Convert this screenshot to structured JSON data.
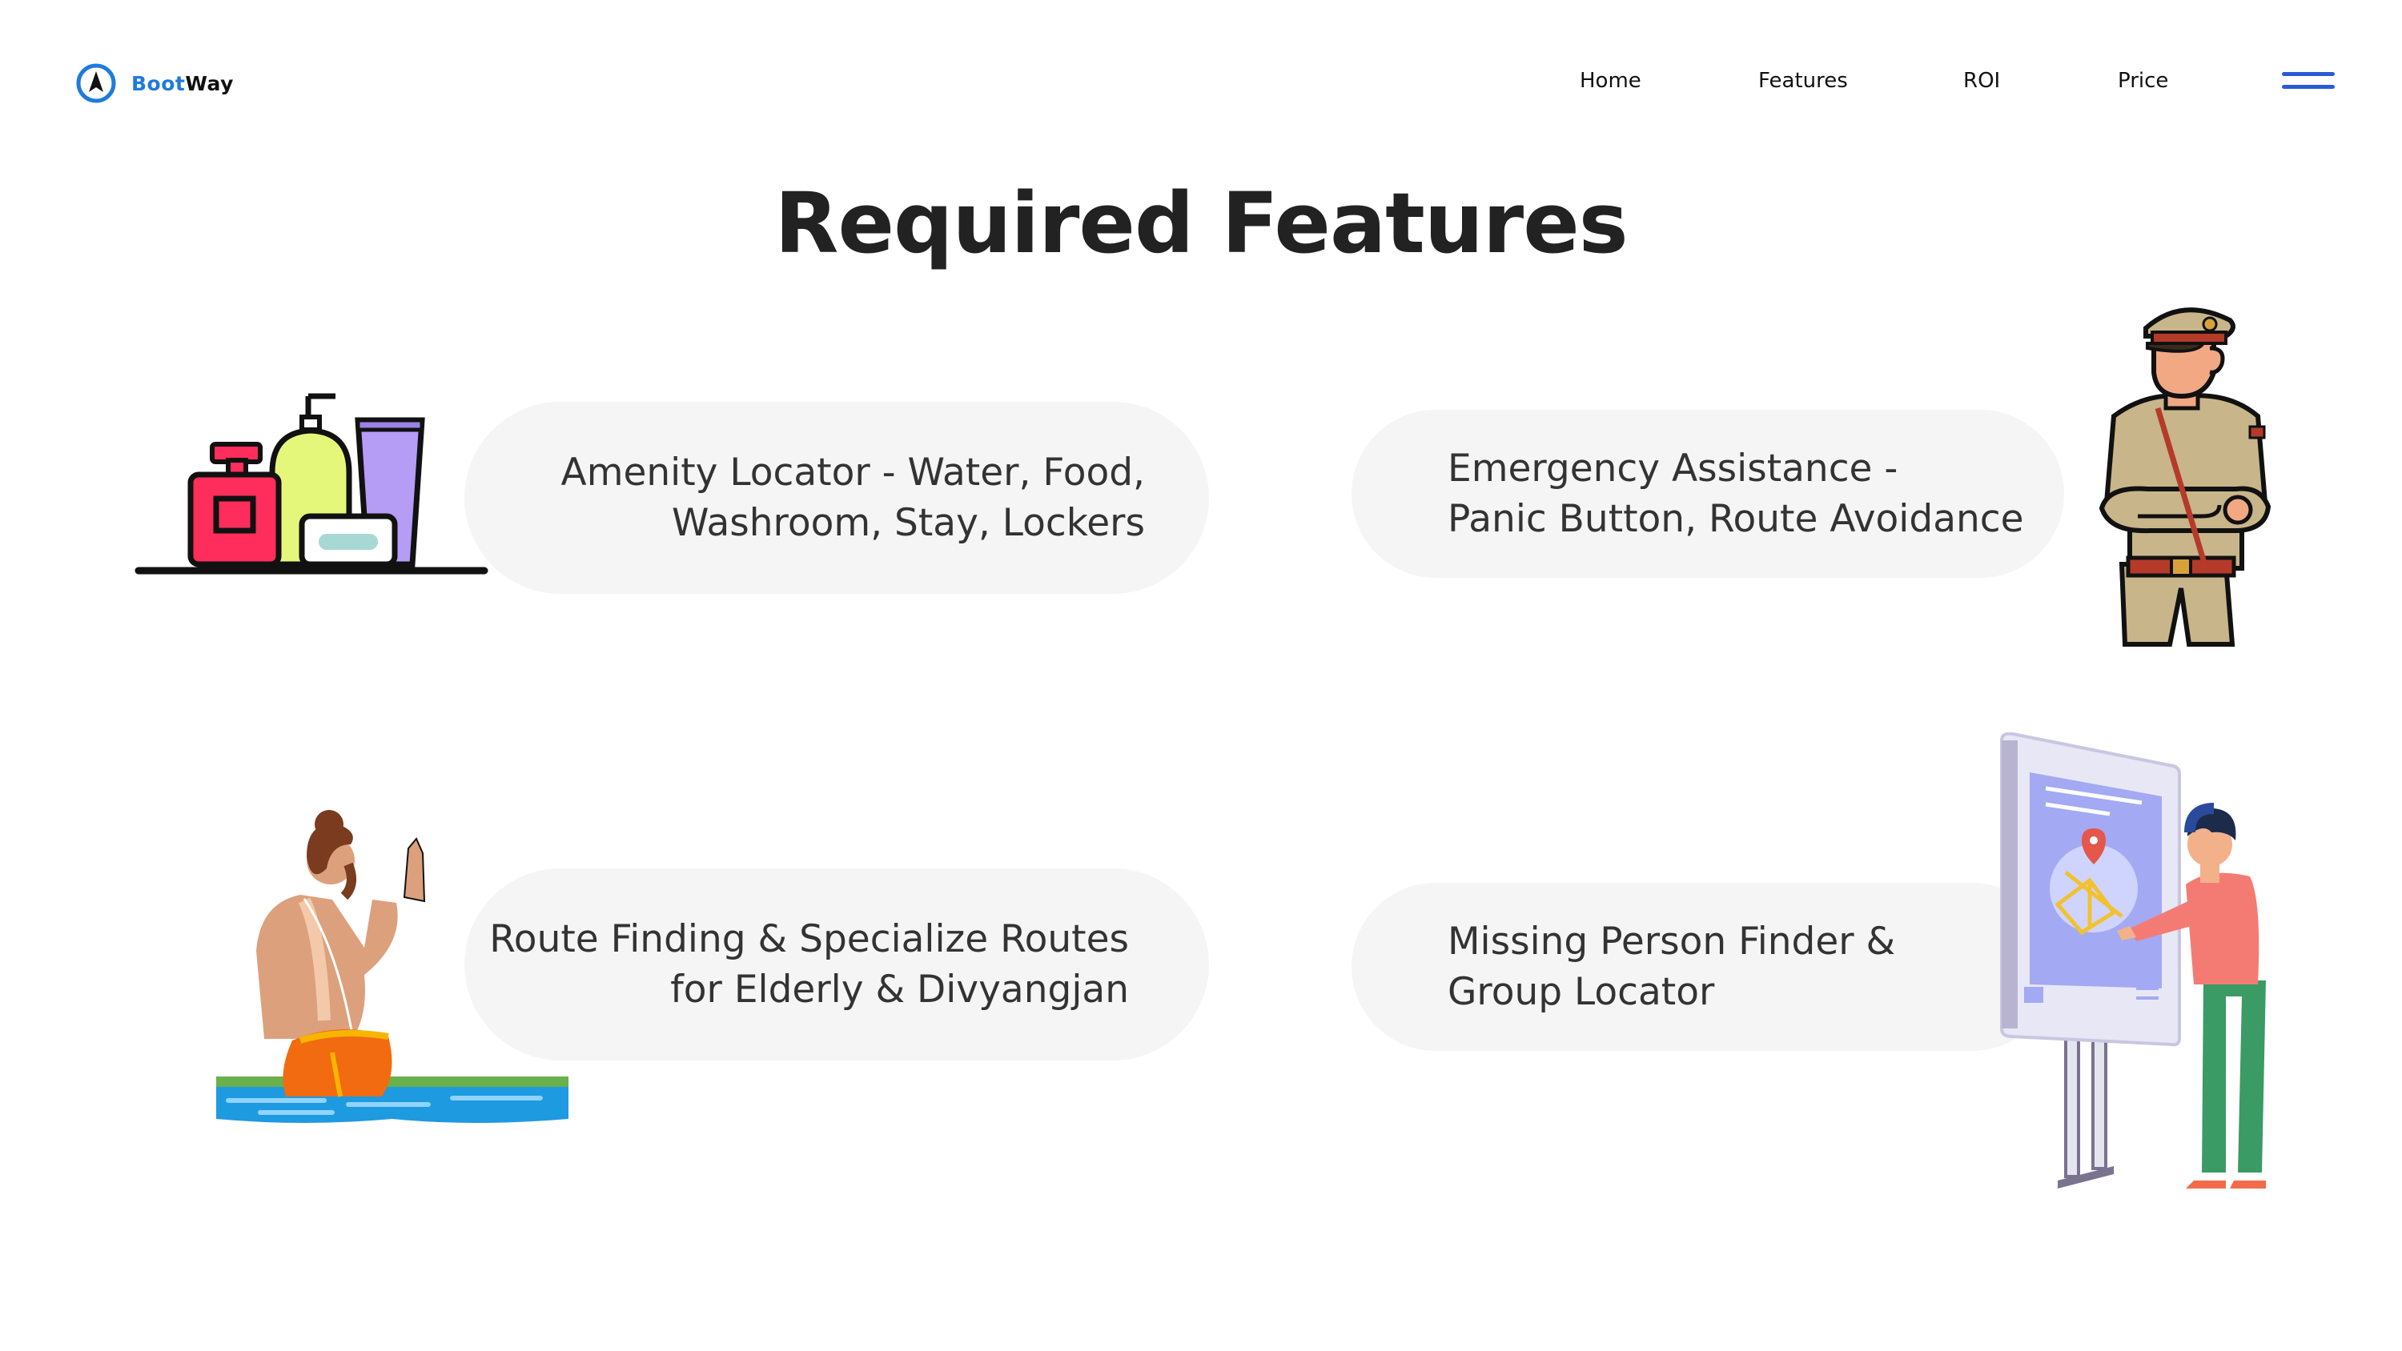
{
  "header": {
    "logo_part1": "Boot",
    "logo_part2": "Way",
    "nav": {
      "home": "Home",
      "features": "Features",
      "roi": "ROI",
      "price": "Price"
    }
  },
  "title": "Required Features",
  "features": [
    {
      "line1": "Amenity Locator - Water, Food,",
      "line2": "Washroom, Stay, Lockers",
      "icon": "toiletries-icon"
    },
    {
      "line1": "Emergency Assistance -",
      "line2": "Panic Button, Route Avoidance",
      "icon": "police-officer-icon"
    },
    {
      "line1": "Route Finding & Specialize Routes",
      "line2": "for Elderly & Divyangjan",
      "icon": "pilgrim-bathing-icon"
    },
    {
      "line1": "Missing Person Finder &",
      "line2": "Group Locator",
      "icon": "map-kiosk-icon"
    }
  ],
  "colors": {
    "brand_blue": "#1f7ae0",
    "menu_blue": "#2a5bd7",
    "card_bg": "#f5f5f5"
  }
}
